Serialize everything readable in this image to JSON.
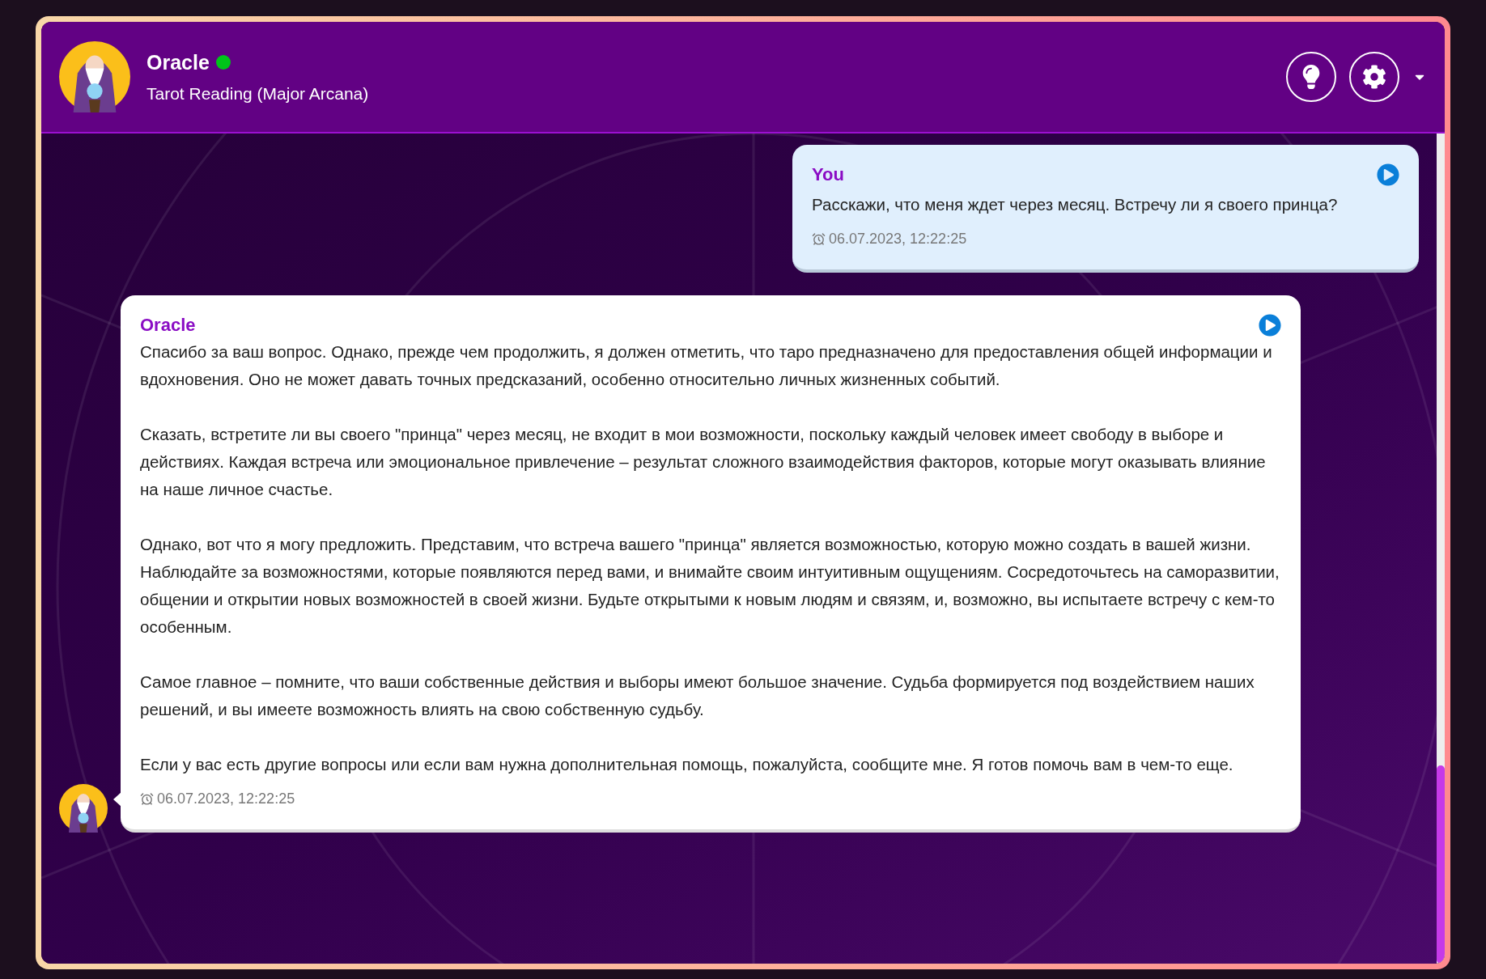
{
  "header": {
    "name": "Oracle",
    "online": true,
    "subtitle": "Tarot Reading (Major Arcana)"
  },
  "messages": [
    {
      "kind": "user",
      "author": "You",
      "paragraphs": [
        "Расскажи, что меня ждет через месяц. Встречу ли я своего принца?"
      ],
      "time": "06.07.2023, 12:22:25"
    },
    {
      "kind": "bot",
      "author": "Oracle",
      "paragraphs": [
        "Спасибо за ваш вопрос. Однако, прежде чем продолжить, я должен отметить, что таро предназначено для предоставления общей информации и вдохновения. Оно не может давать точных предсказаний, особенно относительно личных жизненных событий.",
        "Сказать, встретите ли вы своего \"принца\" через месяц, не входит в мои возможности, поскольку каждый человек имеет свободу в выборе и действиях. Каждая встреча или эмоциональное привлечение – результат сложного взаимодействия факторов, которые могут оказывать влияние на наше личное счастье.",
        "Однако, вот что я могу предложить. Представим, что встреча вашего \"принца\" является возможностью, которую можно создать в вашей жизни. Наблюдайте за возможностями, которые появляются перед вами, и внимайте своим интуитивным ощущениям. Сосредоточьтесь на саморазвитии, общении и открытии новых возможностей в своей жизни. Будьте открытыми к новым людям и связям, и, возможно, вы испытаете встречу с кем-то особенным.",
        "Самое главное – помните, что ваши собственные действия и выборы имеют большое значение. Судьба формируется под воздействием наших решений, и вы имеете возможность влиять на свою собственную судьбу.",
        "Если у вас есть другие вопросы или если вам нужна дополнительная помощь, пожалуйста, сообщите мне. Я готов помочь вам в чем-то еще."
      ],
      "time": "06.07.2023, 12:22:25"
    }
  ]
}
